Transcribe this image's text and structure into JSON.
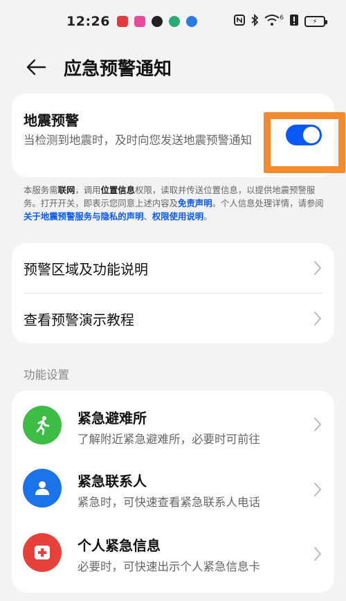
{
  "status": {
    "time": "12:26",
    "signal": "6",
    "battery": "⚡"
  },
  "header": {
    "title": "应急预警通知"
  },
  "quake": {
    "title": "地震预警",
    "desc": "当检测到地震时，及时向您发送地震预警通知",
    "toggle_on": true
  },
  "notice": {
    "p1": "本服务需",
    "b1": "联网",
    "p2": "，调用",
    "b2": "位置信息",
    "p3": "权限，读取并传送位置信息，以提供地震预警服务。打开开关，即表示您同意上述内容及",
    "link1": "免责声明",
    "p4": "。个人信息处理详情，请参阅",
    "link2": "关于地震预警服务与隐私的声明",
    "p5": "、",
    "link3": "权限使用说明",
    "p6": "。"
  },
  "links": [
    {
      "label": "预警区域及功能说明"
    },
    {
      "label": "查看预警演示教程"
    }
  ],
  "section": {
    "label": "功能设置"
  },
  "functions": [
    {
      "title": "紧急避难所",
      "subtitle": "了解附近紧急避难所，必要时可前往",
      "icon": "running-person-icon",
      "color": "#3dbd46"
    },
    {
      "title": "紧急联系人",
      "subtitle": "紧急时，可快速查看紧急联系人电话",
      "icon": "person-icon",
      "color": "#1a73e8"
    },
    {
      "title": "个人紧急信息",
      "subtitle": "必要时，可快速出示个人紧急信息卡",
      "icon": "medical-card-icon",
      "color": "#e8403a"
    }
  ]
}
